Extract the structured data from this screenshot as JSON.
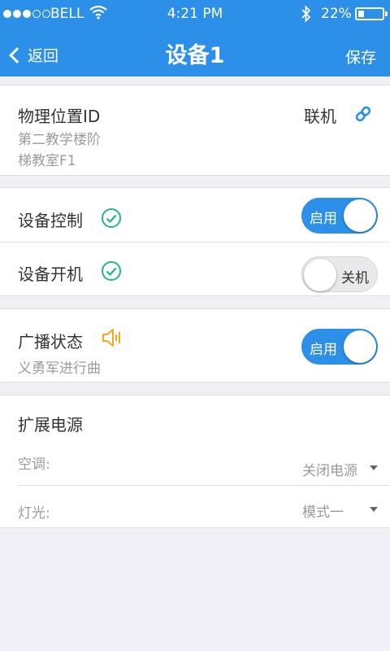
{
  "status_bar": {
    "carrier": "BELL",
    "time": "4:21 PM",
    "battery": "22%"
  },
  "nav": {
    "back_label": "返回",
    "title": "设备1",
    "save_label": "保存"
  },
  "location": {
    "label": "物理位置ID",
    "address_line1": "第二教学楼阶",
    "address_line2": "梯教室F1",
    "status": "联机"
  },
  "controls": {
    "device_control": {
      "label": "设备控制",
      "toggle": "启用"
    },
    "device_power": {
      "label": "设备开机",
      "toggle": "关机"
    }
  },
  "broadcast": {
    "label": "广播状态",
    "track": "义勇军进行曲",
    "toggle": "启用"
  },
  "extended_power": {
    "title": "扩展电源",
    "rows": [
      {
        "label": "空调:",
        "value": "关闭电源"
      },
      {
        "label": "灯光:",
        "value": "模式一"
      }
    ]
  },
  "colors": {
    "accent": "#2c8fe8",
    "check": "#1fb58a",
    "speaker": "#f5a623"
  },
  "icons": {
    "wifi": "wifi-icon",
    "bluetooth": "bluetooth-icon",
    "battery": "battery-icon",
    "back": "chevron-left-icon",
    "link": "link-icon",
    "check": "check-circle-icon",
    "speaker": "speaker-icon",
    "caret": "caret-down-icon"
  }
}
